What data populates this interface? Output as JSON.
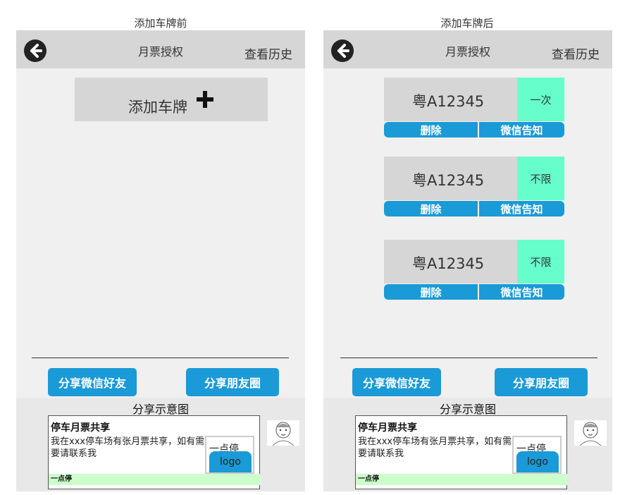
{
  "captions": {
    "before": "添加车牌前",
    "after": "添加车牌后"
  },
  "header": {
    "title": "月票授权",
    "history": "查看历史"
  },
  "add_plate_label": "添加车牌",
  "plates": [
    {
      "number": "粤A12345",
      "tag": "一次"
    },
    {
      "number": "粤A12345",
      "tag": "不限"
    },
    {
      "number": "粤A12345",
      "tag": "不限"
    }
  ],
  "plate_actions": {
    "delete": "删除",
    "notify": "微信告知"
  },
  "share": {
    "wechat_friend": "分享微信好友",
    "moments": "分享朋友圈"
  },
  "example": {
    "title": "分享示意图",
    "card_title": "停车月票共享",
    "card_text": "我在xxx停车场有张月票共享，如有需要请联系我",
    "logo_brand": "一点停",
    "logo_text": "logo",
    "footer": "一点停"
  },
  "colors": {
    "accent": "#1a9ad6",
    "tag": "#66ffcc",
    "panel": "#f0f0f0",
    "bar": "#d6d6d6"
  }
}
